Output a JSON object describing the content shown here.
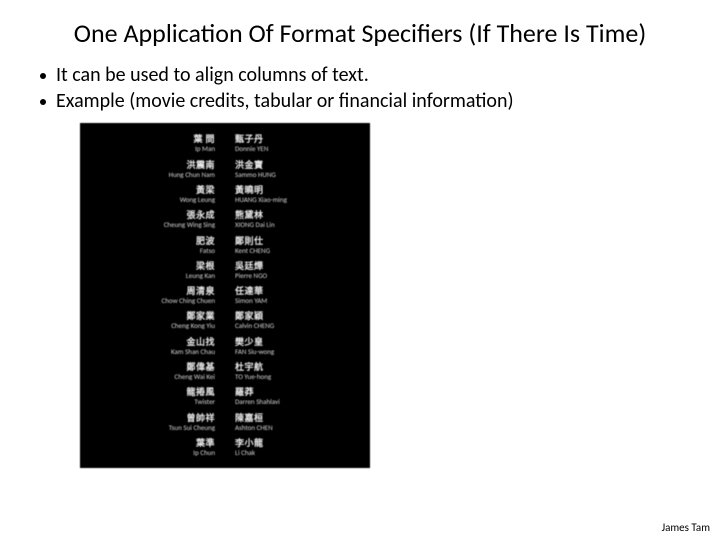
{
  "title": "One Application Of Format Specifiers  (If There Is Time)",
  "bullets": [
    "It can be used to align columns of text.",
    "Example (movie credits, tabular or financial information)"
  ],
  "credits": [
    {
      "l1": "葉 問",
      "l2": "Ip Man",
      "r1": "甄子丹",
      "r2": "Donnie YEN"
    },
    {
      "l1": "洪震南",
      "l2": "Hung Chun Nam",
      "r1": "洪金寶",
      "r2": "Sammo HUNG"
    },
    {
      "l1": "黃梁",
      "l2": "Wong Leung",
      "r1": "黃曉明",
      "r2": "HUANG Xiao-ming"
    },
    {
      "l1": "張永成",
      "l2": "Cheung Wing Sing",
      "r1": "熊黛林",
      "r2": "XIONG Dai Lin"
    },
    {
      "l1": "肥波",
      "l2": "Fatso",
      "r1": "鄭則仕",
      "r2": "Kent CHENG"
    },
    {
      "l1": "梁根",
      "l2": "Leung Kan",
      "r1": "吳廷燁",
      "r2": "Pierre NGO"
    },
    {
      "l1": "周清泉",
      "l2": "Chow Ching Chuen",
      "r1": "任達華",
      "r2": "Simon YAM"
    },
    {
      "l1": "鄭家業",
      "l2": "Cheng Kong Yiu",
      "r1": "鄭家穎",
      "r2": "Calvin CHENG"
    },
    {
      "l1": "金山找",
      "l2": "Kam Shan Chau",
      "r1": "樊少皇",
      "r2": "FAN Siu-wong"
    },
    {
      "l1": "鄭偉基",
      "l2": "Cheng Wai Kei",
      "r1": "杜宇航",
      "r2": "TO Yue-hong"
    },
    {
      "l1": "龍捲風",
      "l2": "Twister",
      "r1": "羅莽",
      "r2": "Darren Shahlavi"
    },
    {
      "l1": "曾帥祥",
      "l2": "Tsun Sui Cheung",
      "r1": "陳嘉桓",
      "r2": "Ashton CHEN"
    },
    {
      "l1": "葉準",
      "l2": "Ip Chun",
      "r1": "李小龍",
      "r2": "Li Chak"
    }
  ],
  "footer": "James Tam"
}
